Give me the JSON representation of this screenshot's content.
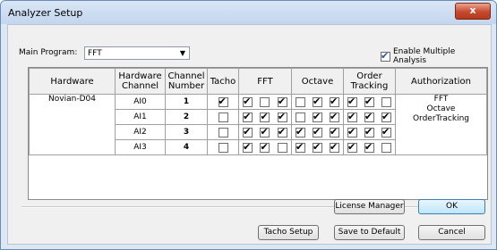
{
  "window": {
    "title": "Analyzer Setup",
    "close_glyph": "x"
  },
  "main_program": {
    "label": "Main Program:",
    "value": "FFT"
  },
  "enable_multiple": {
    "label": "Enable Multiple Analysis",
    "checked": true
  },
  "table": {
    "headers": {
      "hardware": "Hardware",
      "hw_channel": "Hardware Channel",
      "channel_number": "Channel Number",
      "tacho": "Tacho",
      "fft": "FFT",
      "octave": "Octave",
      "order_tracking": "Order Tracking",
      "authorization": "Authorization"
    },
    "hardware_name": "Novian-D04",
    "authorization": [
      "FFT",
      "Octave",
      "OrderTracking"
    ],
    "rows": [
      {
        "channel": "AI0",
        "number": "1",
        "tacho": true,
        "fft": [
          true,
          false,
          true
        ],
        "octave": [
          false,
          true,
          true
        ],
        "order": [
          true,
          true,
          false
        ]
      },
      {
        "channel": "AI1",
        "number": "2",
        "tacho": false,
        "fft": [
          true,
          true,
          true
        ],
        "octave": [
          false,
          true,
          true
        ],
        "order": [
          true,
          true,
          true
        ]
      },
      {
        "channel": "AI2",
        "number": "3",
        "tacho": false,
        "fft": [
          true,
          true,
          true
        ],
        "octave": [
          true,
          true,
          true
        ],
        "order": [
          true,
          true,
          true
        ]
      },
      {
        "channel": "AI3",
        "number": "4",
        "tacho": false,
        "fft": [
          true,
          true,
          false
        ],
        "octave": [
          true,
          true,
          true
        ],
        "order": [
          true,
          true,
          false
        ]
      }
    ]
  },
  "buttons": {
    "license_manager": "License Manager",
    "ok": "OK",
    "tacho_setup": "Tacho Setup",
    "save_default": "Save to Default",
    "cancel": "Cancel"
  },
  "check_glyph": "✔"
}
